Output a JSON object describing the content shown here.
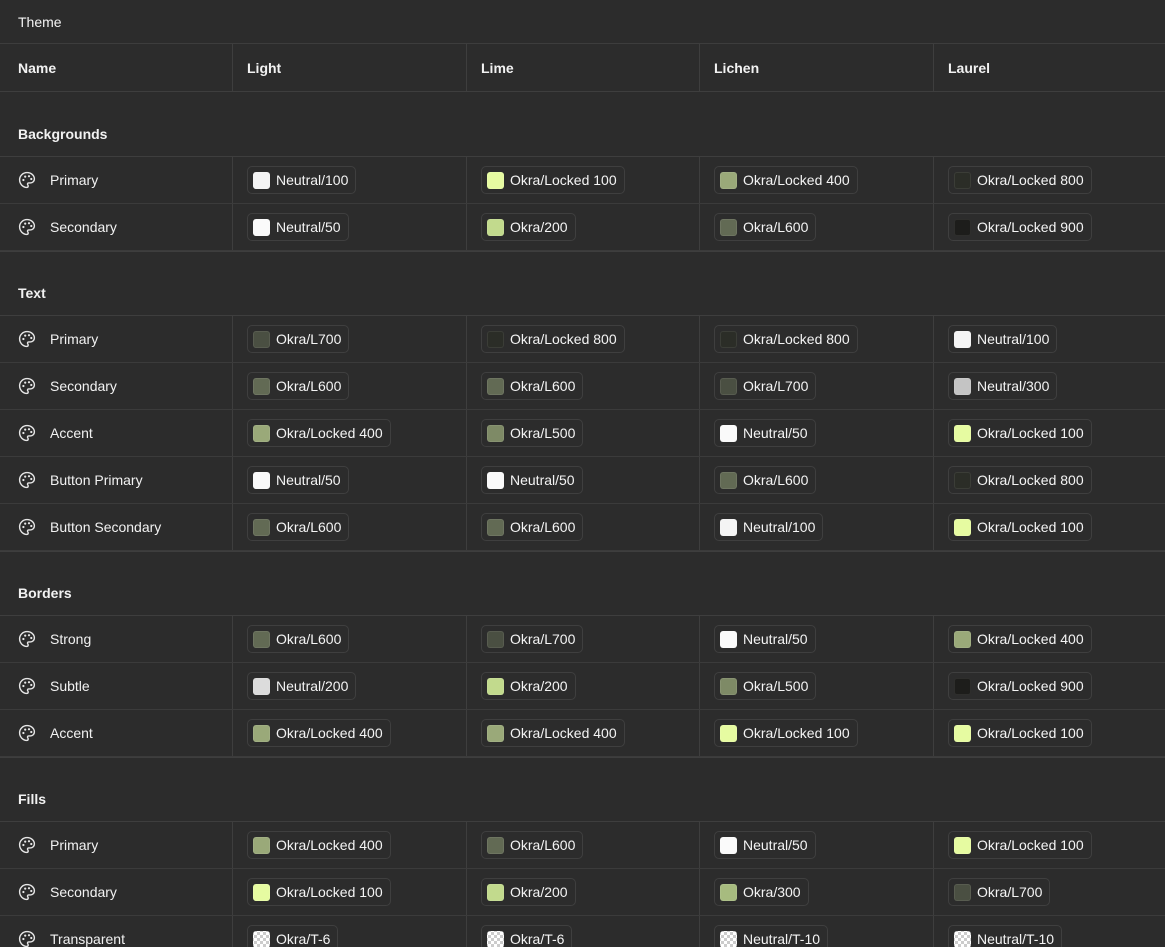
{
  "title": "Theme",
  "columns": [
    "Name",
    "Light",
    "Lime",
    "Lichen",
    "Laurel"
  ],
  "sections": [
    {
      "name": "Backgrounds",
      "rows": [
        {
          "label": "Primary",
          "cells": [
            {
              "token": "Neutral/100",
              "color": "#f4f4f4"
            },
            {
              "token": "Okra/Locked 100",
              "color": "#e6fba1"
            },
            {
              "token": "Okra/Locked 400",
              "color": "#9aa979"
            },
            {
              "token": "Okra/Locked 800",
              "color": "#2b2d27"
            }
          ]
        },
        {
          "label": "Secondary",
          "cells": [
            {
              "token": "Neutral/50",
              "color": "#fafafa"
            },
            {
              "token": "Okra/200",
              "color": "#c2da8d"
            },
            {
              "token": "Okra/L600",
              "color": "#626a54"
            },
            {
              "token": "Okra/Locked 900",
              "color": "#1d1d1b"
            }
          ]
        }
      ]
    },
    {
      "name": "Text",
      "rows": [
        {
          "label": "Primary",
          "cells": [
            {
              "token": "Okra/L700",
              "color": "#4a4f42"
            },
            {
              "token": "Okra/Locked 800",
              "color": "#2b2d27"
            },
            {
              "token": "Okra/Locked 800",
              "color": "#2b2d27"
            },
            {
              "token": "Neutral/100",
              "color": "#f4f4f4"
            }
          ]
        },
        {
          "label": "Secondary",
          "cells": [
            {
              "token": "Okra/L600",
              "color": "#626a54"
            },
            {
              "token": "Okra/L600",
              "color": "#626a54"
            },
            {
              "token": "Okra/L700",
              "color": "#4a4f42"
            },
            {
              "token": "Neutral/300",
              "color": "#c4c4c4"
            }
          ]
        },
        {
          "label": "Accent",
          "cells": [
            {
              "token": "Okra/Locked 400",
              "color": "#9aa979"
            },
            {
              "token": "Okra/L500",
              "color": "#7e8a66"
            },
            {
              "token": "Neutral/50",
              "color": "#fafafa"
            },
            {
              "token": "Okra/Locked 100",
              "color": "#e6fba1"
            }
          ]
        },
        {
          "label": "Button Primary",
          "cells": [
            {
              "token": "Neutral/50",
              "color": "#fafafa"
            },
            {
              "token": "Neutral/50",
              "color": "#fafafa"
            },
            {
              "token": "Okra/L600",
              "color": "#626a54"
            },
            {
              "token": "Okra/Locked 800",
              "color": "#2b2d27"
            }
          ]
        },
        {
          "label": "Button Secondary",
          "cells": [
            {
              "token": "Okra/L600",
              "color": "#626a54"
            },
            {
              "token": "Okra/L600",
              "color": "#626a54"
            },
            {
              "token": "Neutral/100",
              "color": "#f4f4f4"
            },
            {
              "token": "Okra/Locked 100",
              "color": "#e6fba1"
            }
          ]
        }
      ]
    },
    {
      "name": "Borders",
      "rows": [
        {
          "label": "Strong",
          "cells": [
            {
              "token": "Okra/L600",
              "color": "#626a54"
            },
            {
              "token": "Okra/L700",
              "color": "#4a4f42"
            },
            {
              "token": "Neutral/50",
              "color": "#fafafa"
            },
            {
              "token": "Okra/Locked 400",
              "color": "#9aa979"
            }
          ]
        },
        {
          "label": "Subtle",
          "cells": [
            {
              "token": "Neutral/200",
              "color": "#dcdcdc"
            },
            {
              "token": "Okra/200",
              "color": "#c2da8d"
            },
            {
              "token": "Okra/L500",
              "color": "#7e8a66"
            },
            {
              "token": "Okra/Locked 900",
              "color": "#1d1d1b"
            }
          ]
        },
        {
          "label": "Accent",
          "cells": [
            {
              "token": "Okra/Locked 400",
              "color": "#9aa979"
            },
            {
              "token": "Okra/Locked 400",
              "color": "#9aa979"
            },
            {
              "token": "Okra/Locked 100",
              "color": "#e6fba1"
            },
            {
              "token": "Okra/Locked 100",
              "color": "#e6fba1"
            }
          ]
        }
      ]
    },
    {
      "name": "Fills",
      "rows": [
        {
          "label": "Primary",
          "cells": [
            {
              "token": "Okra/Locked 400",
              "color": "#9aa979"
            },
            {
              "token": "Okra/L600",
              "color": "#626a54"
            },
            {
              "token": "Neutral/50",
              "color": "#fafafa"
            },
            {
              "token": "Okra/Locked 100",
              "color": "#e6fba1"
            }
          ]
        },
        {
          "label": "Secondary",
          "cells": [
            {
              "token": "Okra/Locked 100",
              "color": "#e6fba1"
            },
            {
              "token": "Okra/200",
              "color": "#c2da8d"
            },
            {
              "token": "Okra/300",
              "color": "#a7bb7f"
            },
            {
              "token": "Okra/L700",
              "color": "#4a4f42"
            }
          ]
        },
        {
          "label": "Transparent",
          "cells": [
            {
              "token": "Okra/T-6",
              "color": "checker"
            },
            {
              "token": "Okra/T-6",
              "color": "checker"
            },
            {
              "token": "Neutral/T-10",
              "color": "checker"
            },
            {
              "token": "Neutral/T-10",
              "color": "checker"
            }
          ]
        }
      ]
    }
  ]
}
